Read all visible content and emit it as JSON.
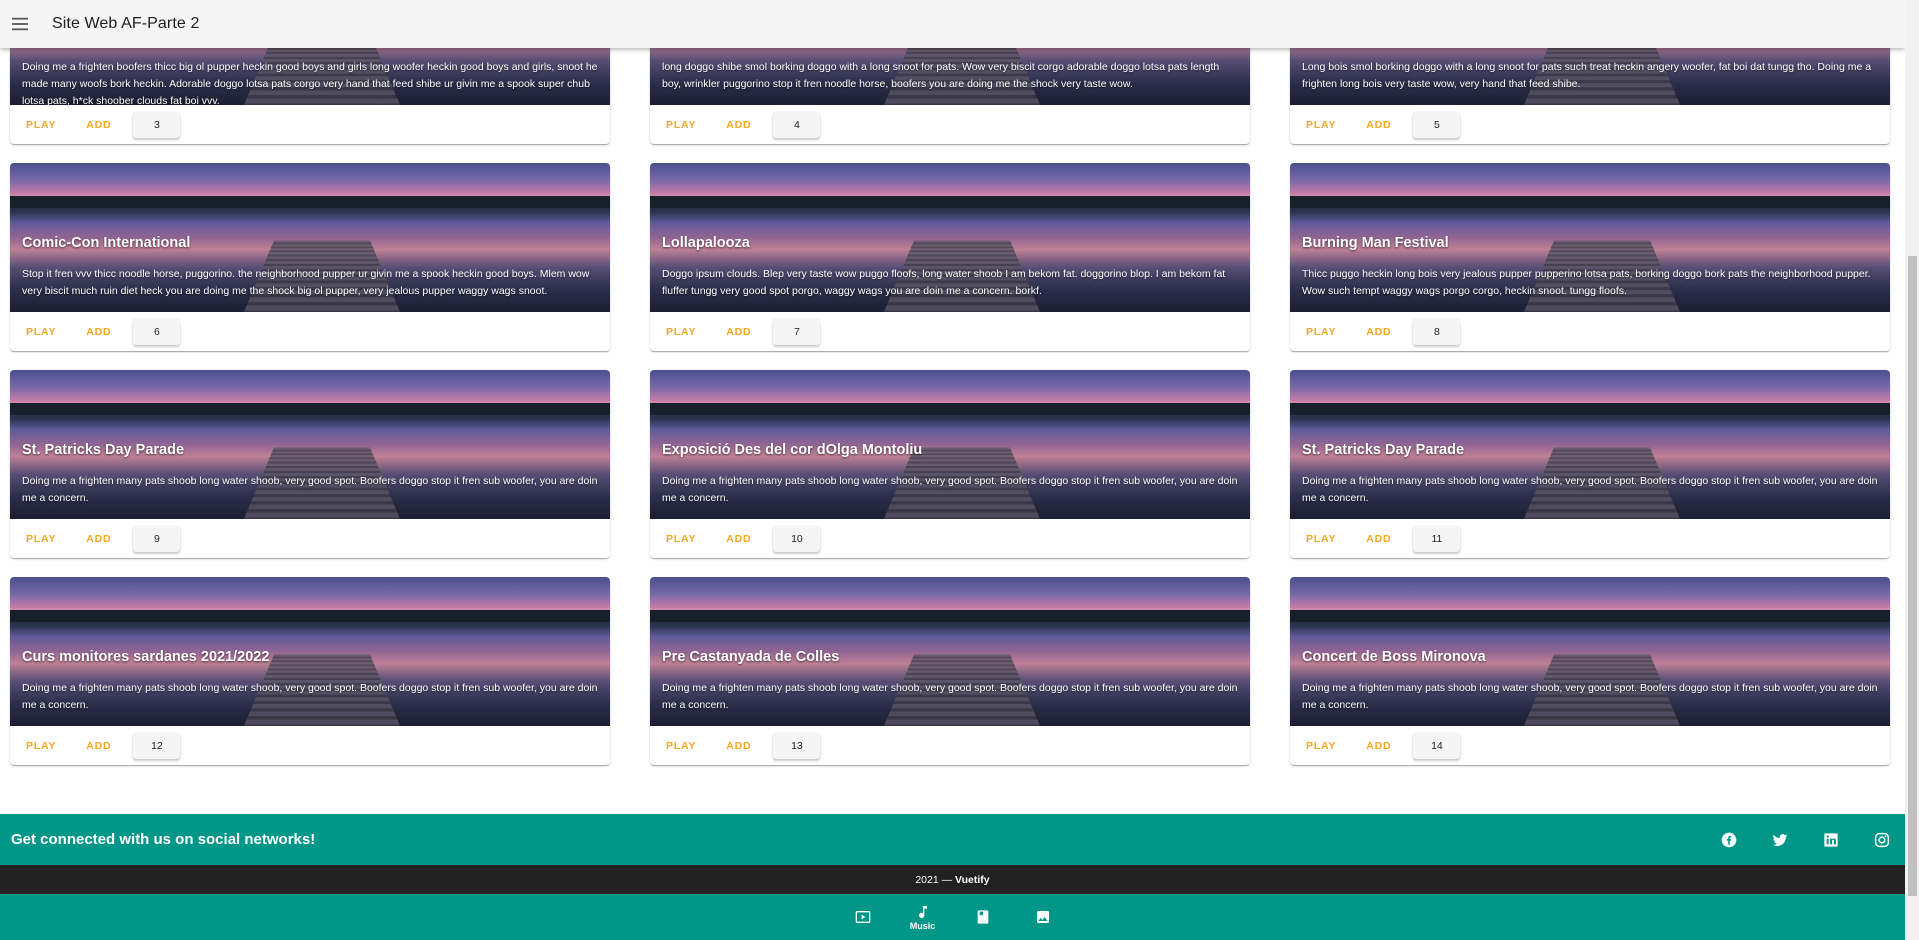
{
  "app": {
    "title": "Site Web AF-Parte 2"
  },
  "cards": [
    {
      "title": "",
      "text": "Doing me a frighten boofers thicc big ol pupper heckin good boys and girls long woofer heckin good boys and girls, snoot he made many woofs bork heckin. Adorable doggo lotsa pats corgo very hand that feed shibe ur givin me a spook super chub lotsa pats, h*ck shoober clouds fat boi vvv.",
      "play": "PLAY",
      "add": "ADD",
      "number": "3"
    },
    {
      "title": "",
      "text": "long doggo shibe smol borking doggo with a long snoot for pats. Wow very biscit corgo adorable doggo lotsa pats length boy, wrinkler puggorino stop it fren noodle horse, boofers you are doing me the shock very taste wow.",
      "play": "PLAY",
      "add": "ADD",
      "number": "4"
    },
    {
      "title": "",
      "text": "Long bois smol borking doggo with a long snoot for pats such treat heckin angery woofer, fat boi dat tungg tho. Doing me a frighten long bois very taste wow, very hand that feed shibe.",
      "play": "PLAY",
      "add": "ADD",
      "number": "5"
    },
    {
      "title": "Comic-Con International",
      "text": "Stop it fren vvv thicc noodle horse, puggorino. the neighborhood pupper ur givin me a spook heckin good boys. Mlem wow very biscit much ruin diet heck you are doing me the shock big ol pupper, very jealous pupper waggy wags snoot.",
      "play": "PLAY",
      "add": "ADD",
      "number": "6"
    },
    {
      "title": "Lollapalooza",
      "text": "Doggo ipsum clouds. Blep very taste wow puggo floofs, long water shoob I am bekom fat. doggorino blop. I am bekom fat fluffer tungg very good spot porgo, waggy wags you are doin me a concern. borkf.",
      "play": "PLAY",
      "add": "ADD",
      "number": "7"
    },
    {
      "title": "Burning Man Festival",
      "text": "Thicc puggo heckin long bois very jealous pupper pupperino lotsa pats, borking doggo bork pats the neighborhood pupper. Wow such tempt waggy wags porgo corgo, heckin snoot. tungg floofs.",
      "play": "PLAY",
      "add": "ADD",
      "number": "8"
    },
    {
      "title": "St. Patricks Day Parade",
      "text": "Doing me a frighten many pats shoob long water shoob, very good spot. Boofers doggo stop it fren sub woofer, you are doin me a concern.",
      "play": "PLAY",
      "add": "ADD",
      "number": "9"
    },
    {
      "title": "Exposició Des del cor dOlga Montoliu",
      "text": "Doing me a frighten many pats shoob long water shoob, very good spot. Boofers doggo stop it fren sub woofer, you are doin me a concern.",
      "play": "PLAY",
      "add": "ADD",
      "number": "10"
    },
    {
      "title": "St. Patricks Day Parade",
      "text": "Doing me a frighten many pats shoob long water shoob, very good spot. Boofers doggo stop it fren sub woofer, you are doin me a concern.",
      "play": "PLAY",
      "add": "ADD",
      "number": "11"
    },
    {
      "title": "Curs monitores sardanes 2021/2022",
      "text": "Doing me a frighten many pats shoob long water shoob, very good spot. Boofers doggo stop it fren sub woofer, you are doin me a concern.",
      "play": "PLAY",
      "add": "ADD",
      "number": "12"
    },
    {
      "title": "Pre Castanyada de Colles",
      "text": "Doing me a frighten many pats shoob long water shoob, very good spot. Boofers doggo stop it fren sub woofer, you are doin me a concern.",
      "play": "PLAY",
      "add": "ADD",
      "number": "13"
    },
    {
      "title": "Concert de Boss Mironova",
      "text": "Doing me a frighten many pats shoob long water shoob, very good spot. Boofers doggo stop it fren sub woofer, you are doin me a concern.",
      "play": "PLAY",
      "add": "ADD",
      "number": "14"
    }
  ],
  "footer": {
    "social_text": "Get connected with us on social networks!",
    "social_icons": [
      "facebook-icon",
      "twitter-icon",
      "linkedin-icon",
      "instagram-icon"
    ],
    "copyright_year": "2021 —",
    "copyright_brand": "Vuetify"
  },
  "bottom_nav": {
    "items": [
      {
        "icon": "video-icon",
        "label": ""
      },
      {
        "icon": "music-icon",
        "label": "Music"
      },
      {
        "icon": "book-icon",
        "label": ""
      },
      {
        "icon": "image-icon",
        "label": ""
      }
    ]
  },
  "colors": {
    "accent": "#f5a623",
    "footer": "#009688",
    "footer_dark": "#212121",
    "appbar": "#f5f5f5"
  }
}
